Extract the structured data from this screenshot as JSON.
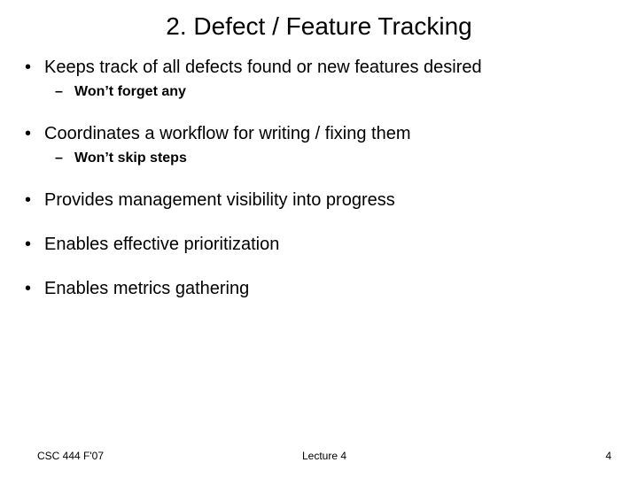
{
  "title": "2. Defect / Feature Tracking",
  "bullets": [
    {
      "text": "Keeps track of all defects found or new features desired",
      "sub": [
        {
          "text": "Won’t forget any"
        }
      ]
    },
    {
      "text": "Coordinates a workflow for writing / fixing them",
      "sub": [
        {
          "text": "Won’t skip steps"
        }
      ]
    },
    {
      "text": "Provides management visibility into progress",
      "sub": []
    },
    {
      "text": "Enables effective prioritization",
      "sub": []
    },
    {
      "text": "Enables metrics gathering",
      "sub": []
    }
  ],
  "footer": {
    "left": "CSC 444 F'07",
    "center": "Lecture 4",
    "right": "4"
  },
  "glyphs": {
    "bullet1": "•",
    "bullet2": "–"
  }
}
